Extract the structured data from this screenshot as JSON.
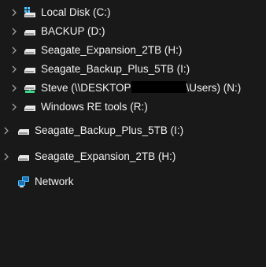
{
  "tree": {
    "items": [
      {
        "label": "Local Disk (C:)",
        "icon": "system-drive-icon",
        "expandable": true
      },
      {
        "label": "BACKUP (D:)",
        "icon": "drive-icon",
        "expandable": true
      },
      {
        "label": "Seagate_Expansion_2TB (H:)",
        "icon": "drive-icon",
        "expandable": true
      },
      {
        "label": "Seagate_Backup_Plus_5TB (I:)",
        "icon": "drive-icon",
        "expandable": true
      },
      {
        "label_prefix": "Steve (\\\\DESKTOP",
        "label_suffix": "\\Users) (N:)",
        "icon": "network-drive-icon",
        "expandable": true
      },
      {
        "label": "Windows RE tools (R:)",
        "icon": "drive-icon",
        "expandable": true
      },
      {
        "label": "Seagate_Backup_Plus_5TB (I:)",
        "icon": "drive-icon",
        "expandable": true
      },
      {
        "label": "Seagate_Expansion_2TB (H:)",
        "icon": "drive-icon",
        "expandable": true
      },
      {
        "label": "Network",
        "icon": "network-icon",
        "expandable": false
      }
    ]
  },
  "colors": {
    "background": "#191919",
    "text": "#f2f2f2",
    "chevron": "#a0a0a0",
    "drive_body": "#e8e8e8",
    "drive_light": "#3dd68c",
    "windows_blue": "#4cc2ff"
  }
}
